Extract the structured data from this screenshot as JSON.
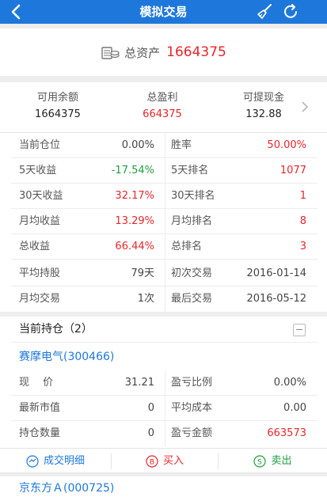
{
  "nav": {
    "title": "模拟交易",
    "icons": [
      "back-icon",
      "broom-icon",
      "refresh-icon"
    ],
    "bar_color": "#1e78db"
  },
  "assets": {
    "label": "总资产",
    "value": "1664375",
    "icon": "coins-icon"
  },
  "summary": {
    "available": {
      "label": "可用余额",
      "value": "1664375"
    },
    "profit": {
      "label": "总盈利",
      "value": "664375"
    },
    "withdrawable": {
      "label": "可提现金",
      "value": "132.88"
    }
  },
  "stats": [
    {
      "l1": "当前仓位",
      "v1": "0.00%",
      "l2": "胜率",
      "v2": "50.00%"
    },
    {
      "l1": "5天收益",
      "v1": "-17.54%",
      "l2": "5天排名",
      "v2": "1077"
    },
    {
      "l1": "30天收益",
      "v1": "32.17%",
      "l2": "30天排名",
      "v2": "1"
    },
    {
      "l1": "月均收益",
      "v1": "13.29%",
      "l2": "月均排名",
      "v2": "8"
    },
    {
      "l1": "总收益",
      "v1": "66.44%",
      "l2": "总排名",
      "v2": "3"
    },
    {
      "l1": "平均持股",
      "v1": "79天",
      "l2": "初次交易",
      "v2": "2016-01-14"
    },
    {
      "l1": "月均交易",
      "v1": "1次",
      "l2": "最后交易",
      "v2": "2016-05-12"
    }
  ],
  "holdings": {
    "title": "当前持仓（2）",
    "stock1": {
      "name": "赛摩电气(300466)",
      "rows": [
        {
          "l1": "现　 价",
          "v1": "31.21",
          "l2": "盈亏比例",
          "v2": "0.00%"
        },
        {
          "l1": "最新市值",
          "v1": "0",
          "l2": "平均成本",
          "v2": "0.00"
        },
        {
          "l1": "持仓数量",
          "v1": "0",
          "l2": "盈亏金额",
          "v2": "663573"
        }
      ]
    },
    "actions": {
      "detail": "成交明细",
      "buy": "买入",
      "sell": "卖出"
    },
    "stock2": {
      "name": "京东方Ａ(000725)"
    }
  },
  "colors": {
    "accent": "#1e78db",
    "positive": "#e8262b",
    "negative": "#1e9e3e"
  }
}
